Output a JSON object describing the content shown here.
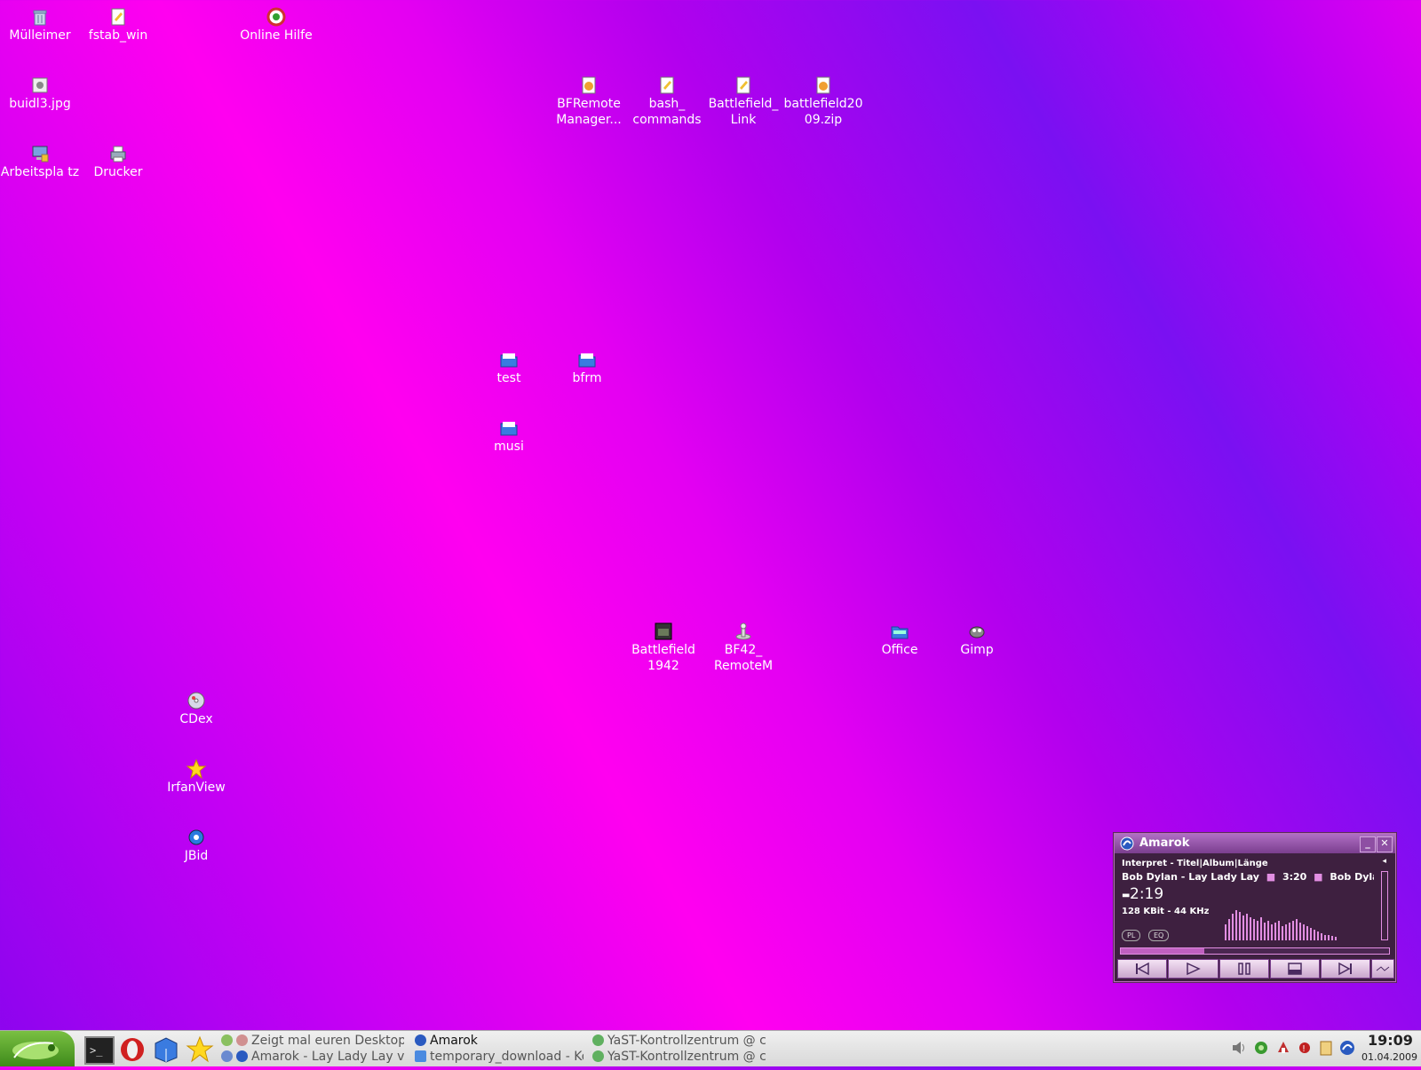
{
  "desktop": {
    "icons": [
      {
        "id": "muelleimer",
        "label": "Mülleimer",
        "icon": "trash-icon"
      },
      {
        "id": "fstab",
        "label": "fstab_win",
        "icon": "text-file-icon"
      },
      {
        "id": "onlinehilfe",
        "label": "Online Hilfe",
        "icon": "help-icon"
      },
      {
        "id": "buidl3",
        "label": "buidl3.jpg",
        "icon": "image-file-icon"
      },
      {
        "id": "bfremote",
        "label": "BFRemote Manager...",
        "icon": "archive-icon"
      },
      {
        "id": "bash",
        "label": "bash_ commands",
        "icon": "text-file-icon"
      },
      {
        "id": "bflink",
        "label": "Battlefield_ Link",
        "icon": "text-file-icon"
      },
      {
        "id": "bfzip",
        "label": "battlefield20 09.zip",
        "icon": "archive-icon"
      },
      {
        "id": "arbeitsplatz",
        "label": "Arbeitspla tz",
        "icon": "computer-icon"
      },
      {
        "id": "drucker",
        "label": "Drucker",
        "icon": "printer-icon"
      },
      {
        "id": "test",
        "label": "test",
        "icon": "folder-icon"
      },
      {
        "id": "bfrm",
        "label": "bfrm",
        "icon": "folder-icon"
      },
      {
        "id": "musi",
        "label": "musi",
        "icon": "folder-icon"
      },
      {
        "id": "bf1942",
        "label": "Battlefield 1942",
        "icon": "game-icon"
      },
      {
        "id": "bf42remote",
        "label": "BF42_ RemoteM",
        "icon": "joystick-icon"
      },
      {
        "id": "office",
        "label": "Office",
        "icon": "office-folder-icon"
      },
      {
        "id": "gimp",
        "label": "Gimp",
        "icon": "gimp-icon"
      },
      {
        "id": "cdex",
        "label": "CDex",
        "icon": "cd-icon"
      },
      {
        "id": "irfanview",
        "label": "IrfanView",
        "icon": "star-icon"
      },
      {
        "id": "jbid",
        "label": "JBid",
        "icon": "gear-icon"
      }
    ]
  },
  "amarok": {
    "title": "Amarok",
    "header_line": "Interpret - Titel|Album|Länge",
    "scroll_text_a": "Bob Dylan - Lay Lady Lay",
    "scroll_len": "3:20",
    "scroll_text_b": "Bob Dylan - Lay L",
    "time": "2:19",
    "bitrate": "128 KBit - 44 KHz",
    "pl_label": "PL",
    "eq_label": "EQ",
    "progress_fraction": 0.31
  },
  "taskbar": {
    "tasks": [
      {
        "label": "Zeigt mal euren Desktop! -",
        "icon": "browser-icon"
      },
      {
        "label": "Amarok",
        "icon": "amarok-icon"
      },
      {
        "label": "YaST-Kontrollzentrum @ c",
        "icon": "yast-icon"
      },
      {
        "label": "Amarok - Lay Lady Lay vom",
        "icon": "amarok-icon"
      },
      {
        "label": "temporary_download - Kon",
        "icon": "folder-icon"
      },
      {
        "label": "YaST-Kontrollzentrum @ c",
        "icon": "yast-icon"
      }
    ],
    "clock_time": "19:09",
    "clock_date": "01.04.2009"
  },
  "colors": {
    "amarok_bg": "#3e2040",
    "amarok_accent": "#e28ee2",
    "taskbar_bg": "#e4e4e4"
  }
}
